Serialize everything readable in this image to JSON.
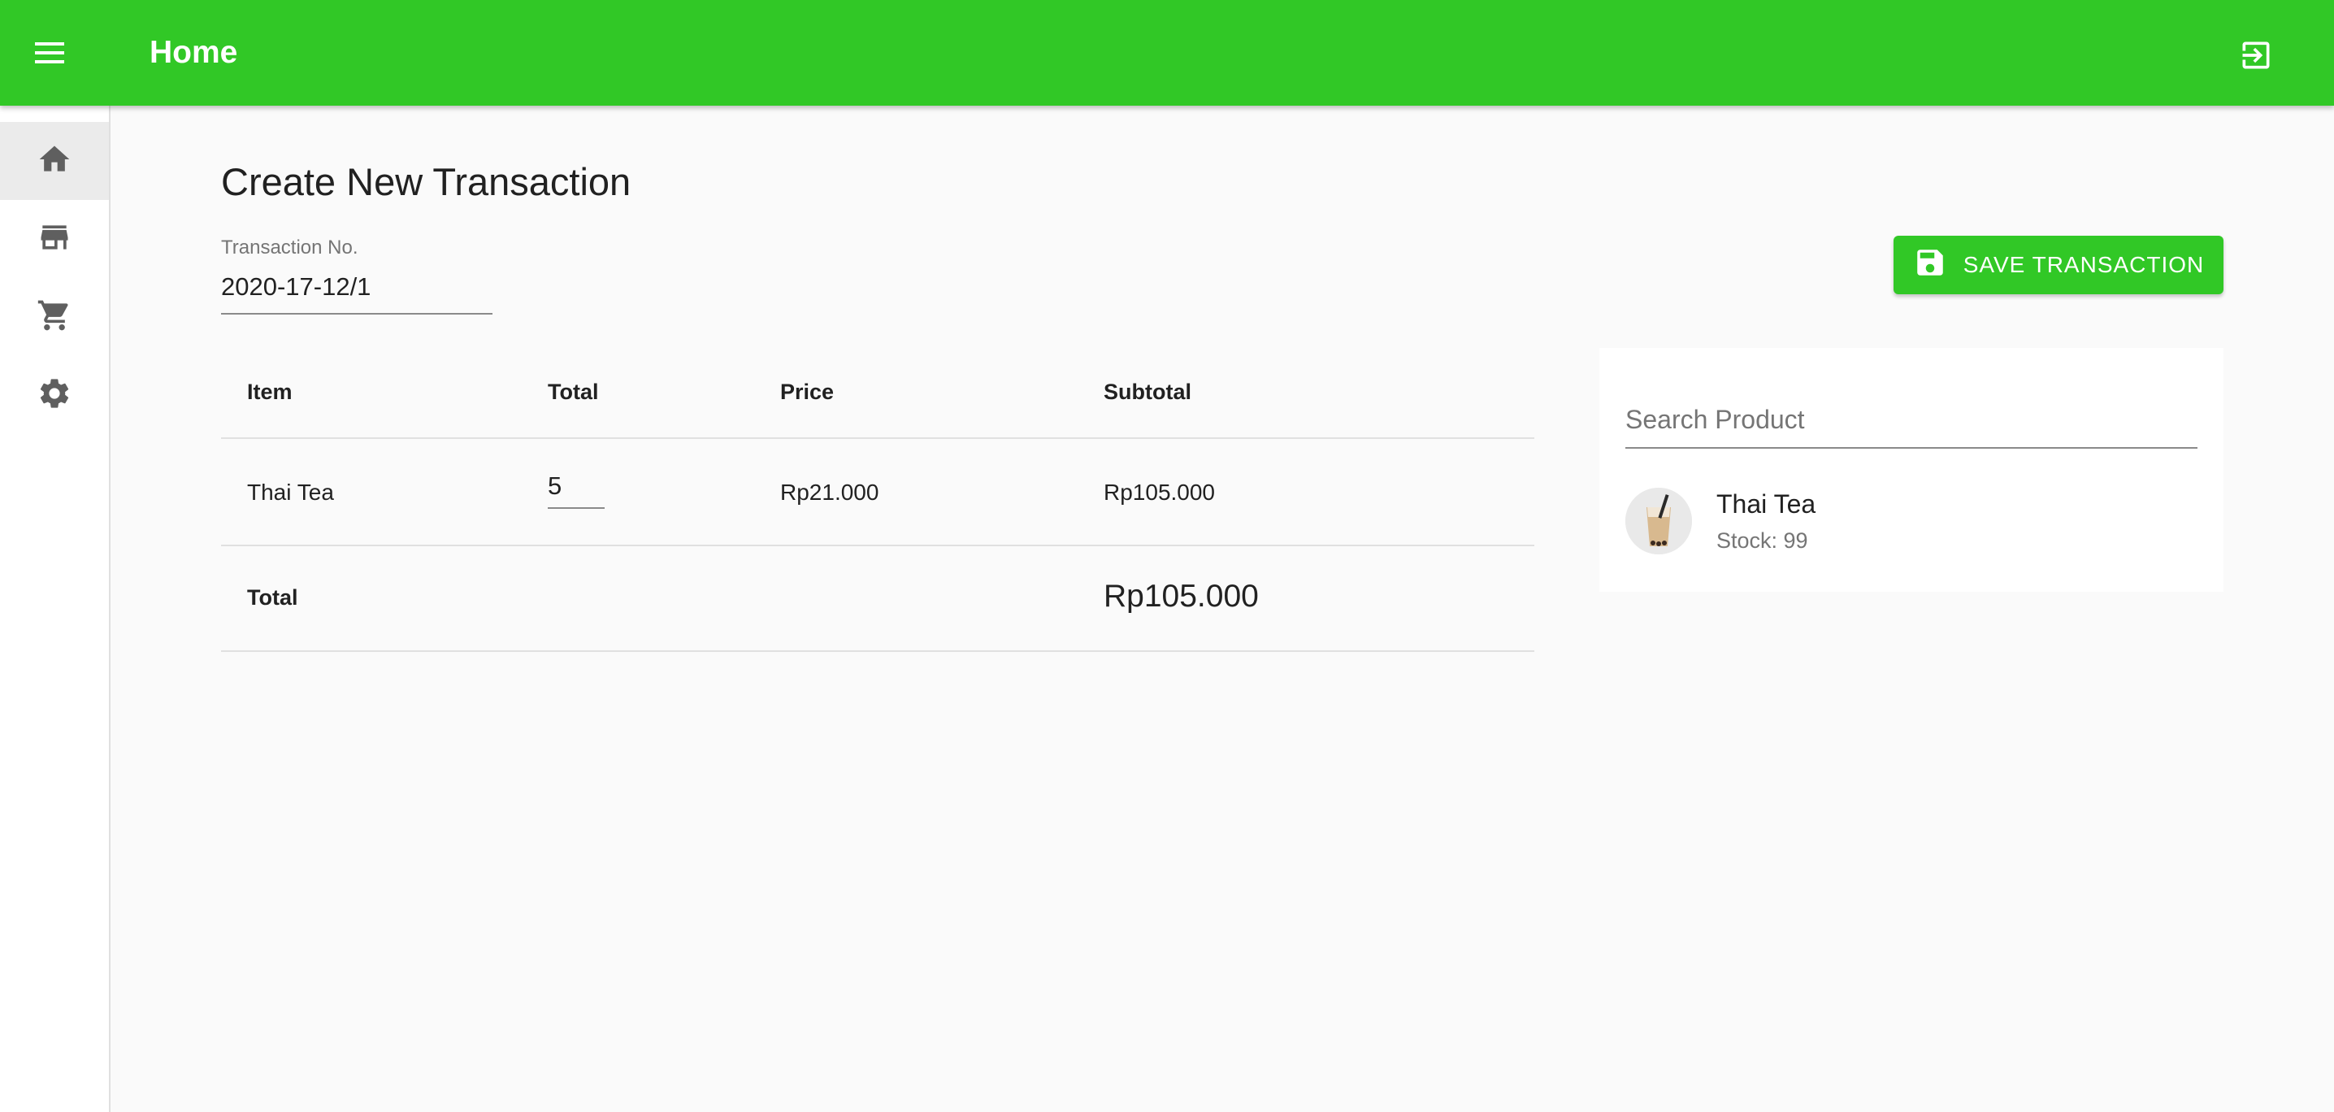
{
  "appbar": {
    "title": "Home",
    "color": "#31c826",
    "menu_icon": "menu-icon",
    "logout_icon": "logout-icon"
  },
  "sidebar": {
    "items": [
      {
        "icon": "home-icon",
        "active": true
      },
      {
        "icon": "store-icon",
        "active": false
      },
      {
        "icon": "cart-icon",
        "active": false
      },
      {
        "icon": "settings-icon",
        "active": false
      }
    ]
  },
  "main": {
    "title": "Create New Transaction",
    "transaction_no": {
      "label": "Transaction No.",
      "value": "2020-17-12/1"
    },
    "save_button": {
      "label": "SAVE TRANSACTION",
      "icon": "save-icon"
    },
    "table": {
      "headers": [
        "Item",
        "Total",
        "Price",
        "Subtotal"
      ],
      "rows": [
        {
          "item": "Thai Tea",
          "qty": "5",
          "price": "Rp21.000",
          "subtotal": "Rp105.000"
        }
      ],
      "total_label": "Total",
      "total_value": "Rp105.000"
    }
  },
  "product_panel": {
    "search_placeholder": "Search Product",
    "products": [
      {
        "name": "Thai Tea",
        "stock": "Stock: 99"
      }
    ]
  }
}
